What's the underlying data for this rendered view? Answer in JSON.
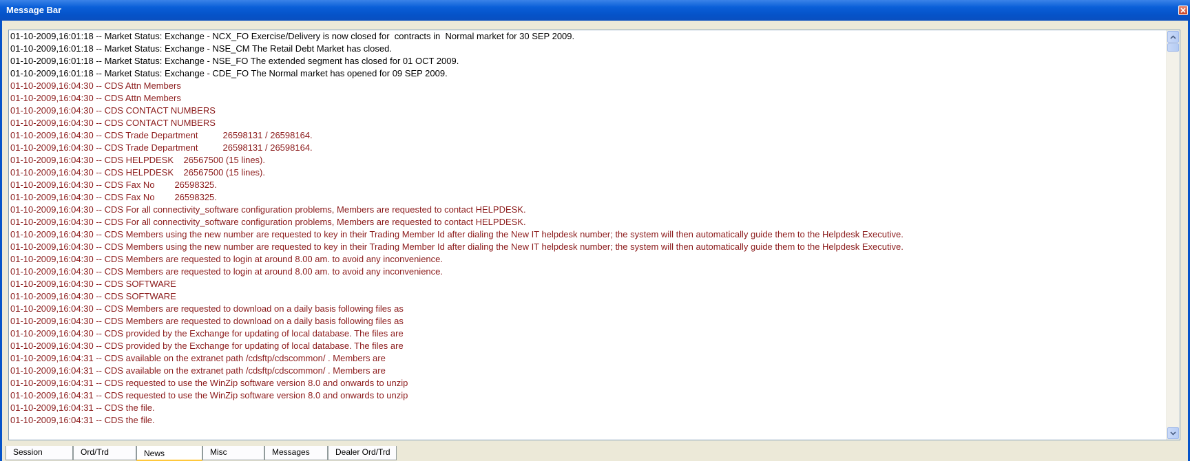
{
  "window": {
    "title": "Message Bar"
  },
  "colors": {
    "market_status_text": "#000000",
    "cds_text": "#8b1a1a",
    "title_bar": "#0553c9",
    "active_tab_accent": "#ffc83c"
  },
  "messages": [
    {
      "text": "01-10-2009,16:01:18 -- Market Status: Exchange - NCX_FO Exercise/Delivery is now closed for  contracts in  Normal market for 30 SEP 2009.",
      "kind": "market"
    },
    {
      "text": "01-10-2009,16:01:18 -- Market Status: Exchange - NSE_CM The Retail Debt Market has closed.",
      "kind": "market"
    },
    {
      "text": "01-10-2009,16:01:18 -- Market Status: Exchange - NSE_FO The extended segment has closed for 01 OCT 2009.",
      "kind": "market"
    },
    {
      "text": "01-10-2009,16:01:18 -- Market Status: Exchange - CDE_FO The Normal market has opened for 09 SEP 2009.",
      "kind": "market"
    },
    {
      "text": "01-10-2009,16:04:30 -- CDS Attn Members",
      "kind": "cds"
    },
    {
      "text": "01-10-2009,16:04:30 -- CDS Attn Members",
      "kind": "cds"
    },
    {
      "text": "01-10-2009,16:04:30 -- CDS CONTACT NUMBERS",
      "kind": "cds"
    },
    {
      "text": "01-10-2009,16:04:30 -- CDS CONTACT NUMBERS",
      "kind": "cds"
    },
    {
      "text": "01-10-2009,16:04:30 -- CDS Trade Department          26598131 / 26598164.",
      "kind": "cds"
    },
    {
      "text": "01-10-2009,16:04:30 -- CDS Trade Department          26598131 / 26598164.",
      "kind": "cds"
    },
    {
      "text": "01-10-2009,16:04:30 -- CDS HELPDESK    26567500 (15 lines).",
      "kind": "cds"
    },
    {
      "text": "01-10-2009,16:04:30 -- CDS HELPDESK    26567500 (15 lines).",
      "kind": "cds"
    },
    {
      "text": "01-10-2009,16:04:30 -- CDS Fax No        26598325.",
      "kind": "cds"
    },
    {
      "text": "01-10-2009,16:04:30 -- CDS Fax No        26598325.",
      "kind": "cds"
    },
    {
      "text": "01-10-2009,16:04:30 -- CDS For all connectivity_software configuration problems, Members are requested to contact HELPDESK.",
      "kind": "cds"
    },
    {
      "text": "01-10-2009,16:04:30 -- CDS For all connectivity_software configuration problems, Members are requested to contact HELPDESK.",
      "kind": "cds"
    },
    {
      "text": "01-10-2009,16:04:30 -- CDS Members using the new number are requested to key in their Trading Member Id after dialing the New IT helpdesk number; the system will then automatically guide them to the Helpdesk Executive.",
      "kind": "cds"
    },
    {
      "text": "01-10-2009,16:04:30 -- CDS Members using the new number are requested to key in their Trading Member Id after dialing the New IT helpdesk number; the system will then automatically guide them to the Helpdesk Executive.",
      "kind": "cds"
    },
    {
      "text": "01-10-2009,16:04:30 -- CDS Members are requested to login at around 8.00 am. to avoid any inconvenience.",
      "kind": "cds"
    },
    {
      "text": "01-10-2009,16:04:30 -- CDS Members are requested to login at around 8.00 am. to avoid any inconvenience.",
      "kind": "cds"
    },
    {
      "text": "01-10-2009,16:04:30 -- CDS SOFTWARE",
      "kind": "cds"
    },
    {
      "text": "01-10-2009,16:04:30 -- CDS SOFTWARE",
      "kind": "cds"
    },
    {
      "text": "01-10-2009,16:04:30 -- CDS Members are requested to download on a daily basis following files as",
      "kind": "cds"
    },
    {
      "text": "01-10-2009,16:04:30 -- CDS Members are requested to download on a daily basis following files as",
      "kind": "cds"
    },
    {
      "text": "01-10-2009,16:04:30 -- CDS provided by the Exchange for updating of local database. The files are",
      "kind": "cds"
    },
    {
      "text": "01-10-2009,16:04:30 -- CDS provided by the Exchange for updating of local database. The files are",
      "kind": "cds"
    },
    {
      "text": "01-10-2009,16:04:31 -- CDS available on the extranet path /cdsftp/cdscommon/ . Members are",
      "kind": "cds"
    },
    {
      "text": "01-10-2009,16:04:31 -- CDS available on the extranet path /cdsftp/cdscommon/ . Members are",
      "kind": "cds"
    },
    {
      "text": "01-10-2009,16:04:31 -- CDS requested to use the WinZip software version 8.0 and onwards to unzip",
      "kind": "cds"
    },
    {
      "text": "01-10-2009,16:04:31 -- CDS requested to use the WinZip software version 8.0 and onwards to unzip",
      "kind": "cds"
    },
    {
      "text": "01-10-2009,16:04:31 -- CDS the file.",
      "kind": "cds"
    },
    {
      "text": "01-10-2009,16:04:31 -- CDS the file.",
      "kind": "cds"
    }
  ],
  "tabs": [
    {
      "label": "Session",
      "active": false
    },
    {
      "label": "Ord/Trd",
      "active": false
    },
    {
      "label": "News",
      "active": true
    },
    {
      "label": "Misc",
      "active": false
    },
    {
      "label": "Messages",
      "active": false
    },
    {
      "label": "Dealer Ord/Trd",
      "active": false
    }
  ],
  "icons": {
    "close": "close-icon",
    "scroll_up": "arrow-up-icon",
    "scroll_down": "arrow-down-icon"
  }
}
